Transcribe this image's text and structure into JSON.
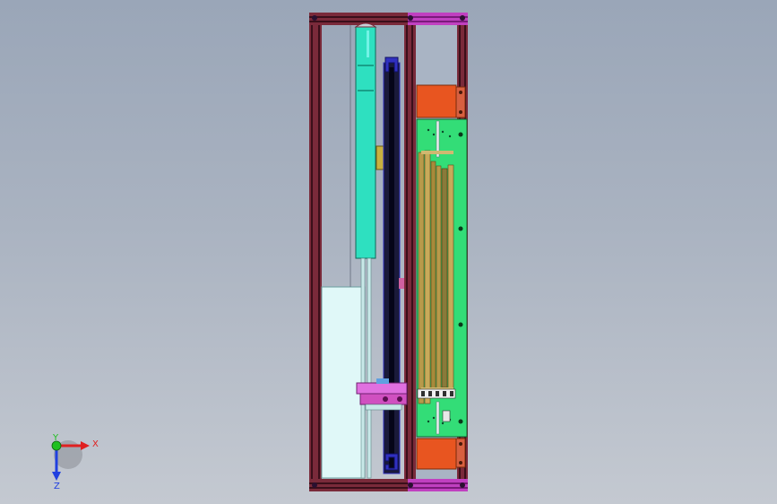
{
  "viewport": {
    "background_top": "#9aa6b8",
    "background_bottom": "#c4c9d1"
  },
  "colors": {
    "frame": "#7a2a3a",
    "frame_edge": "#3a0f1a",
    "magenta_rail": "#c040c0",
    "cyan_part": "#2ee0c0",
    "light_panel": "#e0f8f8",
    "green_plate": "#33dd77",
    "orange_block": "#e85520",
    "dark_channel": "#1a1a3a",
    "blue_bracket": "#3030c0",
    "brass_rail": "#b89a4a",
    "pink_carriage": "#e070e0"
  },
  "triad": {
    "x_label": "X",
    "y_label": "Y",
    "z_label": "Z",
    "x_color": "#e02020",
    "y_color": "#20c020",
    "z_color": "#2040e0"
  },
  "icons": {
    "triad": "coordinate-triad-icon"
  }
}
